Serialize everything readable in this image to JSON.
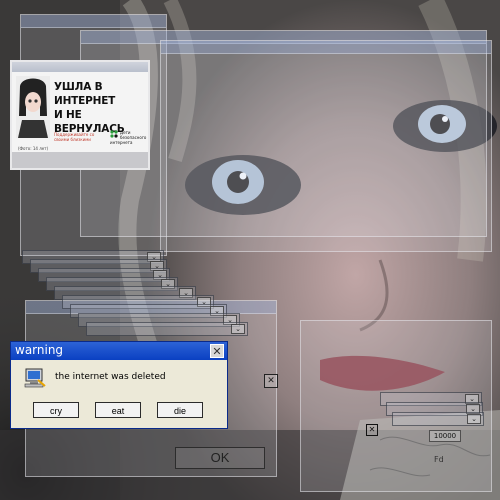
{
  "poster": {
    "headline_line1": "УШЛА В ИНТЕРНЕТ",
    "headline_line2": "И НЕ ВЕРНУЛАСЬ",
    "fineprint": "Поддерживайте со своими близкими",
    "logo_text": "Дети безопасного интернета",
    "caption": "(Фото: 14 лет)"
  },
  "warning": {
    "title": "warning",
    "close_glyph": "✕",
    "message": "the internet was deleted",
    "buttons": [
      "cry",
      "eat",
      "die"
    ]
  },
  "background": {
    "ok_label": "OK",
    "number_label": "10000",
    "mirror_label": "Fd",
    "close_glyph": "✕"
  },
  "colors": {
    "titlebar": "#0a40c2",
    "dialog_bg": "#ece9d8"
  }
}
